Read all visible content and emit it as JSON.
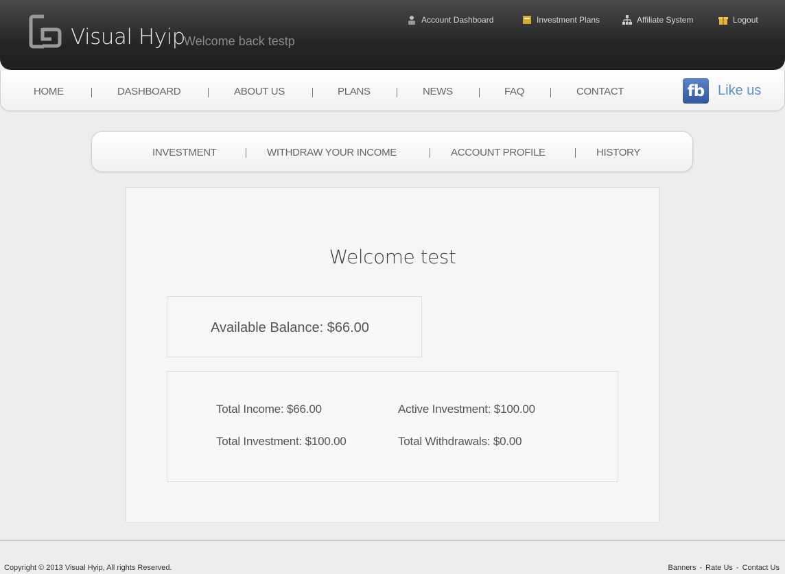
{
  "header": {
    "brand": "Visual Hyip",
    "welcome": "Welcome back testp",
    "toplinks": [
      {
        "label": "Account Dashboard",
        "icon": "user-icon"
      },
      {
        "label": "Investment Plans",
        "icon": "folder-icon"
      },
      {
        "label": "Affiliate System",
        "icon": "network-icon"
      },
      {
        "label": "Logout",
        "icon": "gift-icon"
      }
    ]
  },
  "mainnav": {
    "items": [
      "HOME",
      "DASHBOARD",
      "ABOUT US",
      "PLANS",
      "NEWS",
      "FAQ",
      "CONTACT"
    ],
    "fb_badge": "fb",
    "fb_like": "Like us"
  },
  "subnav": {
    "items": [
      "INVESTMENT",
      "WITHDRAW YOUR INCOME",
      "ACCOUNT PROFILE",
      "HISTORY"
    ]
  },
  "content": {
    "title": "Welcome test",
    "balance": "Available Balance: $66.00",
    "stats": {
      "total_income": "Total Income: $66.00",
      "active_investment": "Active Investment: $100.00",
      "total_investment": "Total Investment: $100.00",
      "total_withdrawals": "Total Withdrawals: $0.00"
    }
  },
  "footer": {
    "copyright": "Copyright © 2013 Visual Hyip, All rights Reserved.",
    "links": [
      "Banners",
      "Rate Us",
      "Contact Us"
    ],
    "separator": "-"
  },
  "colors": {
    "header_dark": "#262626",
    "fb_blue": "#3b5998",
    "like_text": "#5a8fce"
  }
}
